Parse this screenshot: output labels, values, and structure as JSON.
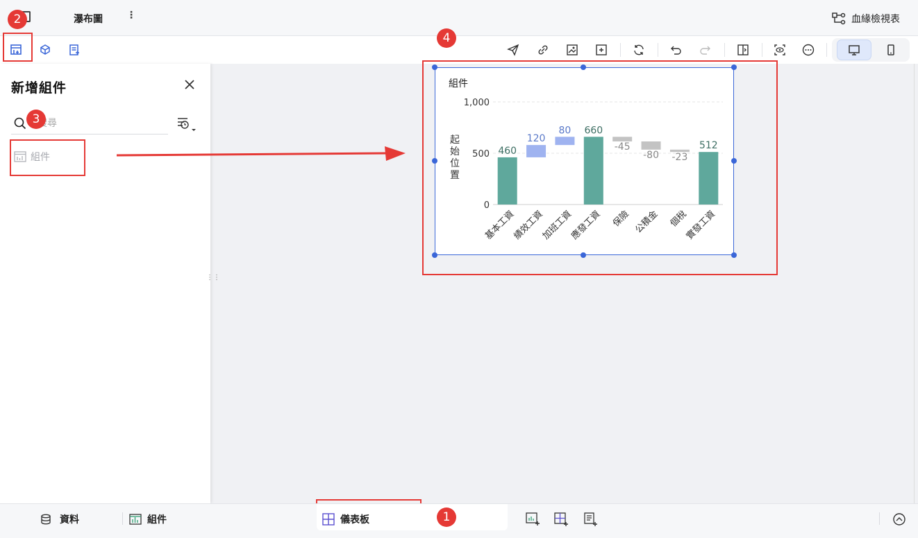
{
  "app": {
    "title": "瀑布圖",
    "more_label": "⋮",
    "lineage_label": "血緣檢視表"
  },
  "toolbar": {
    "left_icons": [
      "add-component-icon",
      "add-cube-icon",
      "add-filter-icon"
    ],
    "right_icons": [
      "send-icon",
      "link-icon",
      "image-icon",
      "fit-icon",
      "refresh-icon",
      "undo-icon",
      "redo-icon",
      "panel-toggle-icon",
      "preview-icon",
      "more-icon",
      "desktop-icon",
      "mobile-icon"
    ]
  },
  "panel": {
    "title": "新增組件",
    "search_placeholder": "搜尋",
    "item_label": "組件"
  },
  "widget": {
    "title": "組件"
  },
  "chart_data": {
    "type": "bar",
    "subtype": "waterfall",
    "ylabel": "起始位置",
    "ylim": [
      0,
      1000
    ],
    "yticks": [
      "0",
      "500",
      "1,000"
    ],
    "grid": true,
    "categories": [
      "基本工資",
      "績效工資",
      "加班工資",
      "應發工資",
      "保險",
      "公積金",
      "個稅",
      "實發工資"
    ],
    "values": [
      460,
      120,
      80,
      660,
      -45,
      -80,
      -23,
      512
    ],
    "labels": [
      "460",
      "120",
      "80",
      "660",
      "-45",
      "-80",
      "-23",
      "512"
    ],
    "kinds": [
      "total",
      "increase",
      "increase",
      "total",
      "decrease",
      "decrease",
      "decrease",
      "total"
    ],
    "colors": {
      "total": "#5fa89c",
      "increase": "#9fb3f0",
      "decrease": "#c3c3c3",
      "label_total": "#3d6e63",
      "label_increase": "#5a79c9",
      "label_decrease": "#888888"
    }
  },
  "annotations": {
    "badges": [
      "1",
      "2",
      "3",
      "4"
    ]
  },
  "bottom": {
    "data_tab": "資料",
    "component_tab": "組件",
    "dashboard_tab": "儀表板"
  }
}
